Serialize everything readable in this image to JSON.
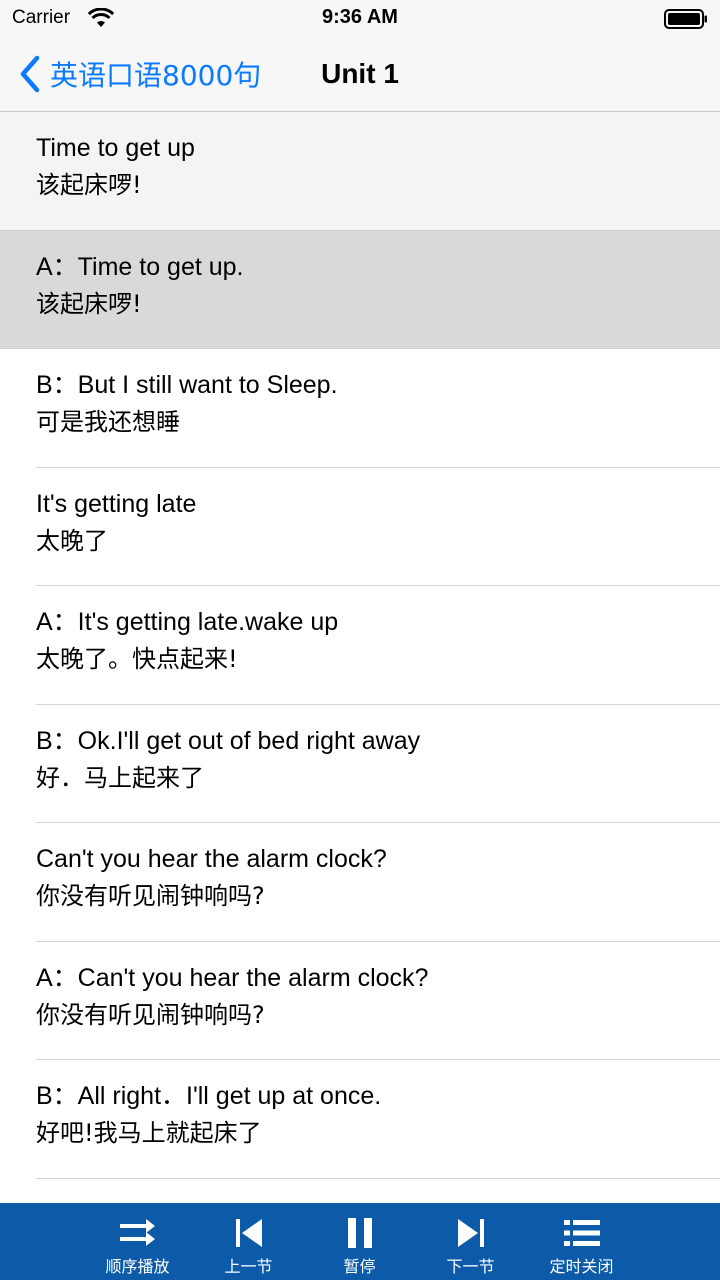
{
  "status_bar": {
    "carrier": "Carrier",
    "time": "9:36 AM"
  },
  "nav": {
    "back_label": "英语口语8000句",
    "title": "Unit 1"
  },
  "rows": [
    {
      "en": "Time to get up",
      "zh": "该起床啰!"
    },
    {
      "en": "A：Time to get up.",
      "zh": "该起床啰!"
    },
    {
      "en": "B：But I still want to Sleep.",
      "zh": "可是我还想睡"
    },
    {
      "en": "It's getting late",
      "zh": "太晚了"
    },
    {
      "en": "A：It's getting late.wake up",
      "zh": "太晚了。快点起来!"
    },
    {
      "en": "B：Ok.I'll get out of bed right away",
      "zh": "好．马上起来了"
    },
    {
      "en": "Can't you hear the alarm clock?",
      "zh": "你没有听见闹钟响吗?"
    },
    {
      "en": "A：Can't you hear the alarm clock?",
      "zh": "你没有听见闹钟响吗?"
    },
    {
      "en": "B：All right．I'll get up at once.",
      "zh": "好吧!我马上就起床了"
    }
  ],
  "toolbar": {
    "order_play": "顺序播放",
    "prev": "上一节",
    "pause": "暂停",
    "next": "下一节",
    "timer_off": "定时关闭"
  },
  "colors": {
    "accent": "#0a7aff",
    "toolbar_bg": "#0d5ba8",
    "selected_row": "#d9d9d9"
  },
  "icons": [
    "wifi-icon",
    "battery-icon",
    "chevron-left-icon",
    "sequence-play-icon",
    "skip-previous-icon",
    "pause-icon",
    "skip-next-icon",
    "list-icon"
  ]
}
